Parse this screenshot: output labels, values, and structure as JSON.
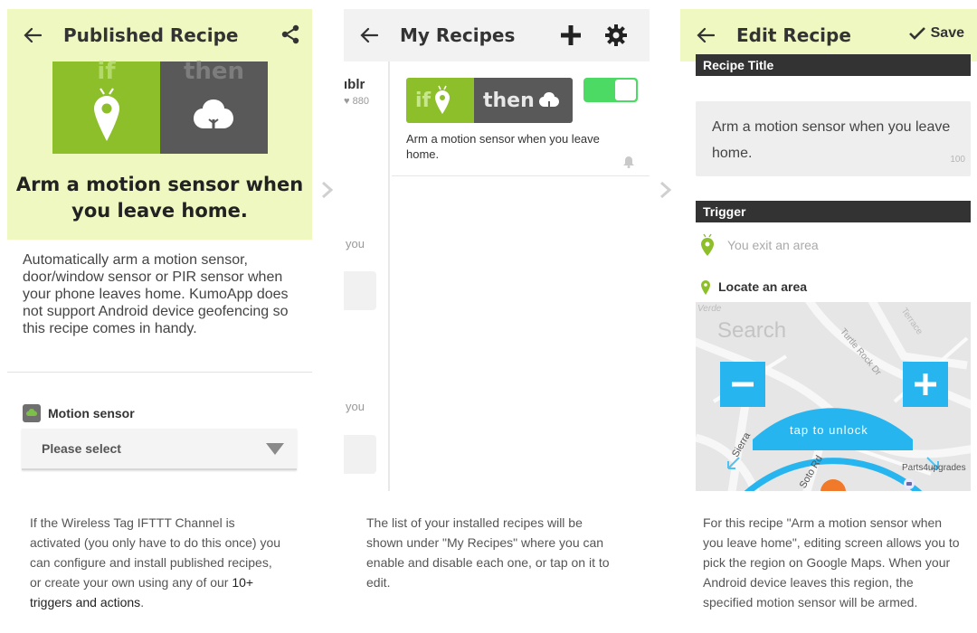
{
  "panel1": {
    "title": "Published Recipe",
    "badge_if": "if",
    "badge_then": "then",
    "recipe_title": "Arm a motion sensor when you leave home.",
    "description": "Automatically arm a motion sensor, door/window sensor or PIR sensor when your phone leaves home. KumoApp does not support Android device geofencing so this recipe comes in handy.",
    "motion_label": "Motion sensor",
    "select_value": "Please select"
  },
  "panel2": {
    "title": "My Recipes",
    "ghost_name": "ıblr",
    "ghost_count": "880",
    "ghost_you_1": "you",
    "ghost_you_2": "you",
    "badge_if": "if",
    "badge_then": "then",
    "recipe_name": "Arm a motion sensor when you leave home.",
    "toggle_on": true
  },
  "panel3": {
    "title": "Edit Recipe",
    "save_label": "Save",
    "recipe_title_heading": "Recipe Title",
    "recipe_title_value": "Arm a motion sensor when you leave home.",
    "char_counter": "100",
    "trigger_heading": "Trigger",
    "trigger_item": "You exit an area",
    "locate_label": "Locate an area",
    "map_search_placeholder": "Search",
    "map_street_1": "Verde",
    "map_street_2": "Sierra",
    "map_street_3": "Soto Rd",
    "map_street_4": "Turtle Rock Dr",
    "map_street_5": "Terrace",
    "map_poi": "Parts4upgrades",
    "unlock_text": "tap to unlock"
  },
  "captions": {
    "cap1_text": "If the Wireless Tag IFTTT Channel is activated (you only have to do this once) you can configure and install published recipes, or create your own using any of our ",
    "cap1_link": "10+ triggers and actions",
    "cap1_end": ".",
    "cap2": "The list of your installed recipes will be shown under \"My Recipes\" where you can enable and disable each one, or tap on it to edit.",
    "cap3": "For this recipe \"Arm a motion sensor when you leave home\", editing screen allows you to pick the region on Google Maps. When your Android device leaves this region, the specified motion sensor will be armed."
  },
  "colors": {
    "header_green": "#eef8c0",
    "if_green": "#8dbf2a",
    "then_gray": "#595959",
    "toggle_green": "#4cd964",
    "map_blue": "#27b5f0"
  }
}
